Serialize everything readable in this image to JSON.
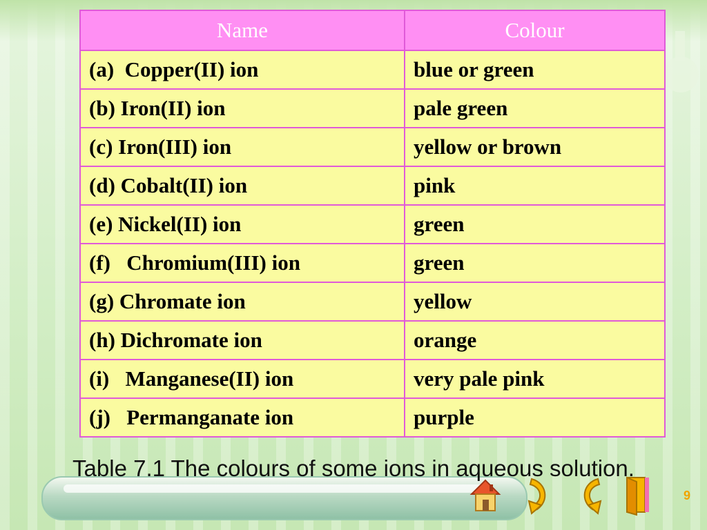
{
  "table": {
    "headers": {
      "name": "Name",
      "colour": "Colour"
    },
    "rows": [
      {
        "name": "(a)  Copper(II) ion",
        "colour": "blue or green"
      },
      {
        "name": "(b) Iron(II) ion",
        "colour": "pale green"
      },
      {
        "name": "(c) Iron(III) ion",
        "colour": "yellow or brown"
      },
      {
        "name": "(d) Cobalt(II) ion",
        "colour": "pink"
      },
      {
        "name": "(e) Nickel(II) ion",
        "colour": "green"
      },
      {
        "name": "(f)   Chromium(III) ion",
        "colour": "green"
      },
      {
        "name": "(g) Chromate ion",
        "colour": "yellow"
      },
      {
        "name": "(h) Dichromate ion",
        "colour": "orange"
      },
      {
        "name": "(i)   Manganese(II) ion",
        "colour": "very pale pink"
      },
      {
        "name": "(j)   Permanganate ion",
        "colour": "purple"
      }
    ]
  },
  "caption": "Table 7.1 The colours of some ions in aqueous solution.",
  "page_number": "9",
  "nav": {
    "home_icon": "house-icon",
    "next_icon": "curved-arrow-next-icon",
    "back_icon": "curved-arrow-back-icon",
    "exit_icon": "door-exit-icon"
  },
  "colors": {
    "header_bg": "#ff8ff3",
    "cell_bg": "#fafba0",
    "border": "#e05ad8",
    "page_number": "#f0a400"
  }
}
